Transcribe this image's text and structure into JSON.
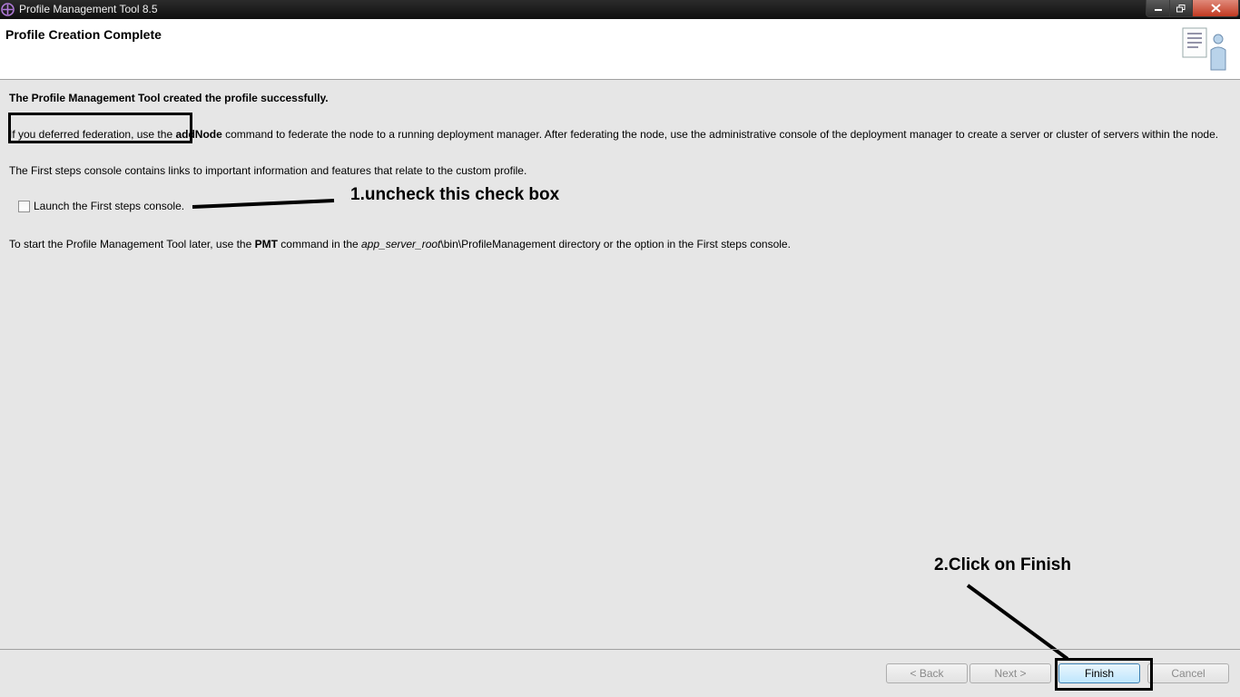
{
  "window": {
    "title": "Profile Management Tool 8.5"
  },
  "header": {
    "title": "Profile Creation Complete"
  },
  "content": {
    "success_message": "The Profile Management Tool created the profile successfully.",
    "federation_pre": "If you deferred federation, use the ",
    "federation_cmd": "addNode",
    "federation_post": " command to federate the node to a running deployment manager. After federating the node, use the administrative console of the deployment manager to create a server or cluster of servers within the node.",
    "first_steps_info": "The First steps console contains links to important information and features that relate to the custom profile.",
    "checkbox_label": "Launch the First steps console.",
    "checkbox_checked": false,
    "pmt_pre": "To start the Profile Management Tool later, use the ",
    "pmt_cmd": "PMT",
    "pmt_mid": " command in the ",
    "pmt_root": "app_server_root",
    "pmt_post": "\\bin\\ProfileManagement directory or the option in the First steps console."
  },
  "annotations": {
    "step1": "1.uncheck this check box",
    "step2": "2.Click on Finish"
  },
  "buttons": {
    "back": "< Back",
    "next": "Next >",
    "finish": "Finish",
    "cancel": "Cancel"
  }
}
